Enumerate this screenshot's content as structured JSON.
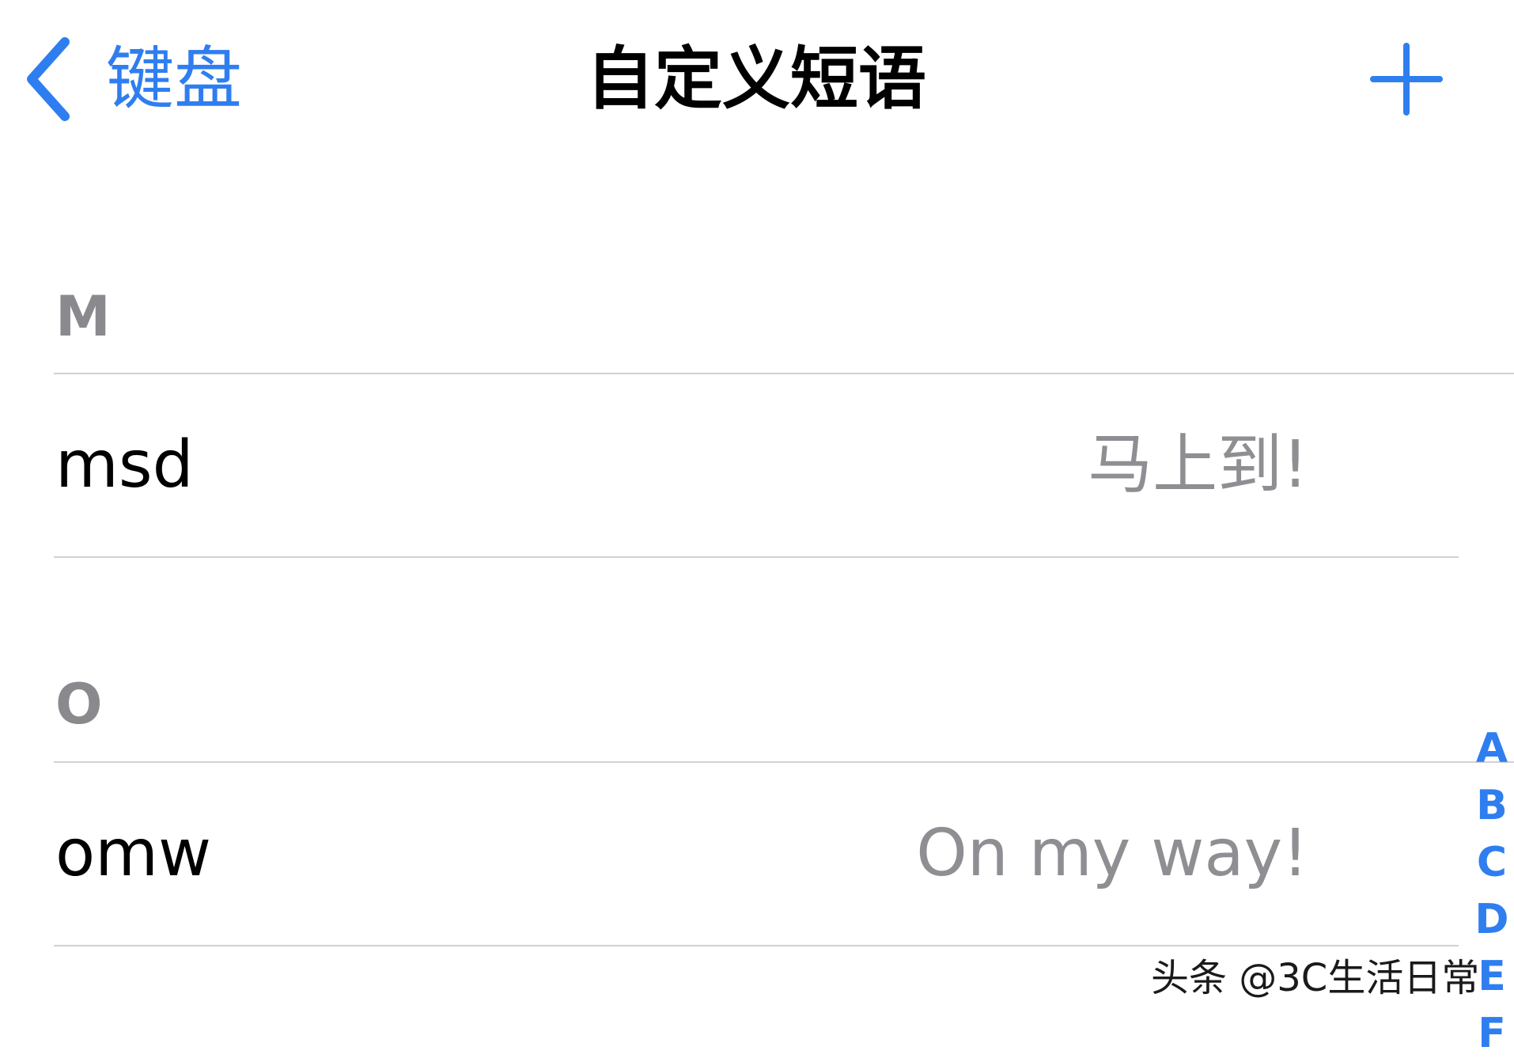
{
  "nav": {
    "back_label": "键盘",
    "title": "自定义短语",
    "add_icon": "plus-icon",
    "back_icon": "chevron-left-icon"
  },
  "colors": {
    "accent": "#2f7ef0",
    "secondary_text": "#8e8e93",
    "section_header": "#8a8a8e",
    "separator": "#d1d1d6"
  },
  "sections": [
    {
      "header": "M",
      "rows": [
        {
          "shortcut": "msd",
          "phrase": "马上到!"
        }
      ]
    },
    {
      "header": "O",
      "rows": [
        {
          "shortcut": "omw",
          "phrase": "On my way!"
        }
      ]
    }
  ],
  "section_index": [
    "A",
    "B",
    "C",
    "D",
    "E",
    "F"
  ],
  "watermark": "头条 @3C生活日常"
}
